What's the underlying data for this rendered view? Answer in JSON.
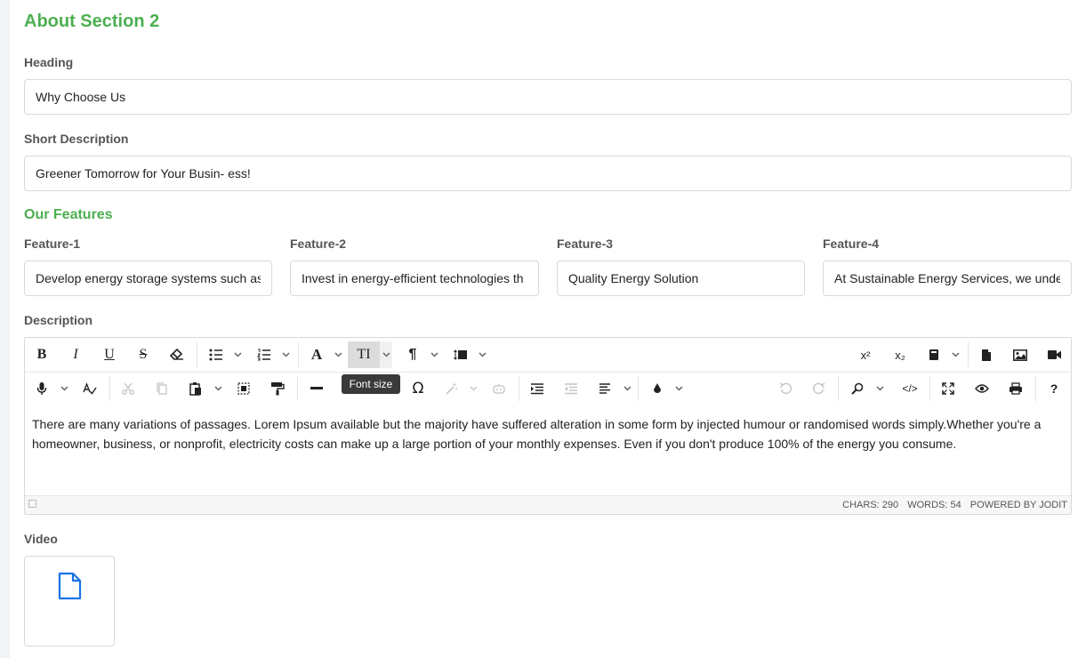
{
  "section": {
    "title": "About Section 2"
  },
  "heading": {
    "label": "Heading",
    "value": "Why Choose Us"
  },
  "short_description": {
    "label": "Short Description",
    "value": "Greener Tomorrow for Your Busin- ess!"
  },
  "features": {
    "title": "Our Features",
    "items": [
      {
        "label": "Feature-1",
        "value": "Develop energy storage systems such as"
      },
      {
        "label": "Feature-2",
        "value": "Invest in energy-efficient technologies th"
      },
      {
        "label": "Feature-3",
        "value": "Quality Energy Solution"
      },
      {
        "label": "Feature-4",
        "value": "At Sustainable Energy Services, we under"
      }
    ]
  },
  "description": {
    "label": "Description",
    "text": "There are many variations of passages. Lorem Ipsum available but the majority have suffered alteration in some form by injected humour or randomised words simply.Whether you're a homeowner, business, or nonprofit, electricity costs can make up a large portion of your monthly expenses. Even if you don't produce 100% of the energy you consume.",
    "tooltip": "Font size",
    "status": {
      "chars": "CHARS: 290",
      "words": "WORDS: 54",
      "powered": "POWERED BY JODIT"
    },
    "toolbar": {
      "bold": "B",
      "italic": "I",
      "underline": "U",
      "strikethrough": "S",
      "font": "A",
      "font_size": "TI",
      "paragraph": "¶",
      "superscript": "x²",
      "subscript": "x₂",
      "special_char": "Ω",
      "source": "</>",
      "help": "?"
    }
  },
  "video": {
    "label": "Video"
  },
  "colors": {
    "accent": "#4caf50",
    "file_icon": "#1a73e8"
  }
}
